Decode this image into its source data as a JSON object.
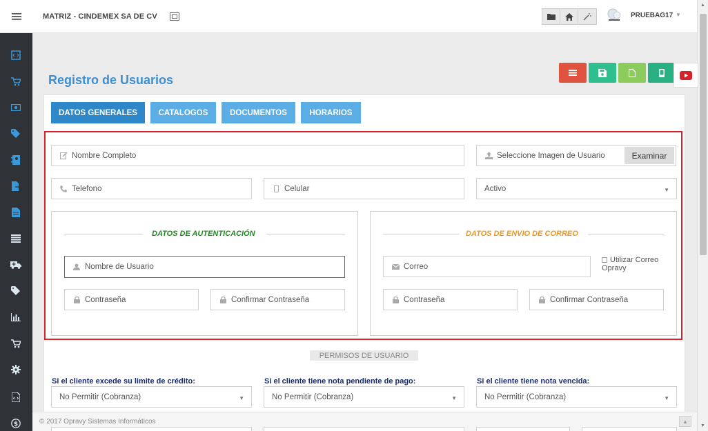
{
  "header": {
    "company": "MATRIZ - CINDEMEX SA DE CV",
    "username": "PRUEBAG17",
    "menu_icon": "hamburger-icon",
    "toolbar_icons": [
      "folder-icon",
      "home-icon",
      "magic-wand-icon"
    ]
  },
  "sidebar": {
    "icons": [
      "code-file-icon",
      "cart-icon",
      "money-icon",
      "tags-icon",
      "address-book-icon",
      "file-export-icon",
      "file-icon",
      "list-icon",
      "ambulance-icon",
      "tags-icon",
      "bar-chart-icon",
      "cart-icon",
      "gear-icon",
      "code-file-icon",
      "dollar-circle-icon"
    ]
  },
  "page": {
    "title": "Registro de Usuarios"
  },
  "actions": {
    "colors": [
      "#e0533e",
      "#2fbf8f",
      "#8ccc5c",
      "#28b082"
    ],
    "icons": [
      "list-icon",
      "save-icon",
      "new-file-icon",
      "mobile-icon"
    ],
    "youtube_icon": "youtube-icon"
  },
  "tabs": [
    {
      "label": "DATOS GENERALES",
      "active": true
    },
    {
      "label": "CATALOGOS",
      "active": false
    },
    {
      "label": "DOCUMENTOS",
      "active": false
    },
    {
      "label": "HORARIOS",
      "active": false
    }
  ],
  "form": {
    "nombre_completo": "Nombre Completo",
    "imagen": "Seleccione Imagen de Usuario",
    "examinar": "Examinar",
    "telefono": "Telefono",
    "celular": "Celular",
    "estado": "Activo"
  },
  "auth": {
    "title": "DATOS DE AUTENTICACIÓN",
    "title_color": "#1e8a1e",
    "usuario": "Nombre de Usuario",
    "contrasena": "Contraseña",
    "confirmar": "Confirmar Contraseña"
  },
  "correo_section": {
    "title": "DATOS DE ENVIO DE CORREO",
    "title_color": "#f0961e",
    "correo": "Correo",
    "utilizar_line1": "Utilizar Correo",
    "utilizar_line2": "Opravy",
    "contrasena": "Contraseña",
    "confirmar": "Confirmar Contraseña"
  },
  "permisos": {
    "title": "PERMISOS DE USUARIO",
    "items": [
      {
        "label": "Si el cliente excede su limite de crédito:",
        "value": "No Permitir (Cobranza)"
      },
      {
        "label": "Si el cliente tiene nota pendiente de pago:",
        "value": "No Permitir (Cobranza)"
      },
      {
        "label": "Si el cliente tiene nota vencida:",
        "value": "No Permitir (Cobranza)"
      }
    ]
  },
  "footer": {
    "text": "© 2017 Opravy Sistemas Informáticos"
  }
}
